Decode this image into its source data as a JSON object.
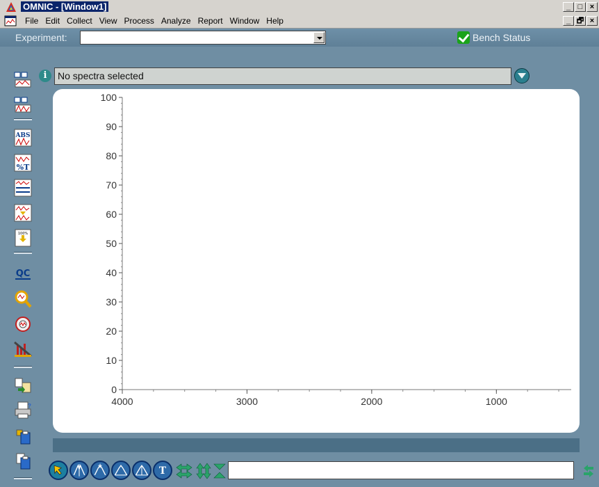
{
  "window": {
    "title": "OMNIC - [Window1]",
    "controls": {
      "minimize": "_",
      "maximize": "□",
      "close": "×",
      "restore": "🗗"
    }
  },
  "menu": {
    "items": [
      "File",
      "Edit",
      "Collect",
      "View",
      "Process",
      "Analyze",
      "Report",
      "Window",
      "Help"
    ]
  },
  "experiment": {
    "label": "Experiment:",
    "value": "",
    "bench_status_label": "Bench Status"
  },
  "info": {
    "message": "No spectra selected",
    "info_glyph": "i"
  },
  "left_toolbar": {
    "icons": [
      "display-spectra-icon",
      "display-spectra-alt-icon",
      "absorbance-icon",
      "percent-transmittance-icon",
      "baseline-correct-icon",
      "automatic-baseline-icon",
      "scale-100-percent-icon",
      "qc-icon",
      "search-icon",
      "spectral-search-icon",
      "peak-analysis-icon",
      "library-setup-icon",
      "print-icon",
      "clipboard-icon",
      "document-icon"
    ],
    "qc_label": "QC",
    "abs_label": "ABS"
  },
  "bottom_toolbar": {
    "tools": [
      "selection-tool",
      "region-tool",
      "peak-height-tool",
      "peak-area-tool",
      "baseline-tool",
      "text-tool"
    ],
    "text_glyph": "T",
    "command_value": ""
  },
  "chart_data": {
    "type": "line",
    "title": "",
    "xlabel": "",
    "ylabel": "",
    "xlim": [
      4000,
      400
    ],
    "ylim": [
      0,
      100
    ],
    "x_ticks": [
      4000,
      3000,
      2000,
      1000
    ],
    "y_ticks": [
      0,
      10,
      20,
      30,
      40,
      50,
      60,
      70,
      80,
      90,
      100
    ],
    "series": []
  },
  "colors": {
    "frame": "#6f8ea3",
    "accent": "#0a246a",
    "plot_bg": "#ffffff",
    "status_strip": "#4b6f86"
  }
}
